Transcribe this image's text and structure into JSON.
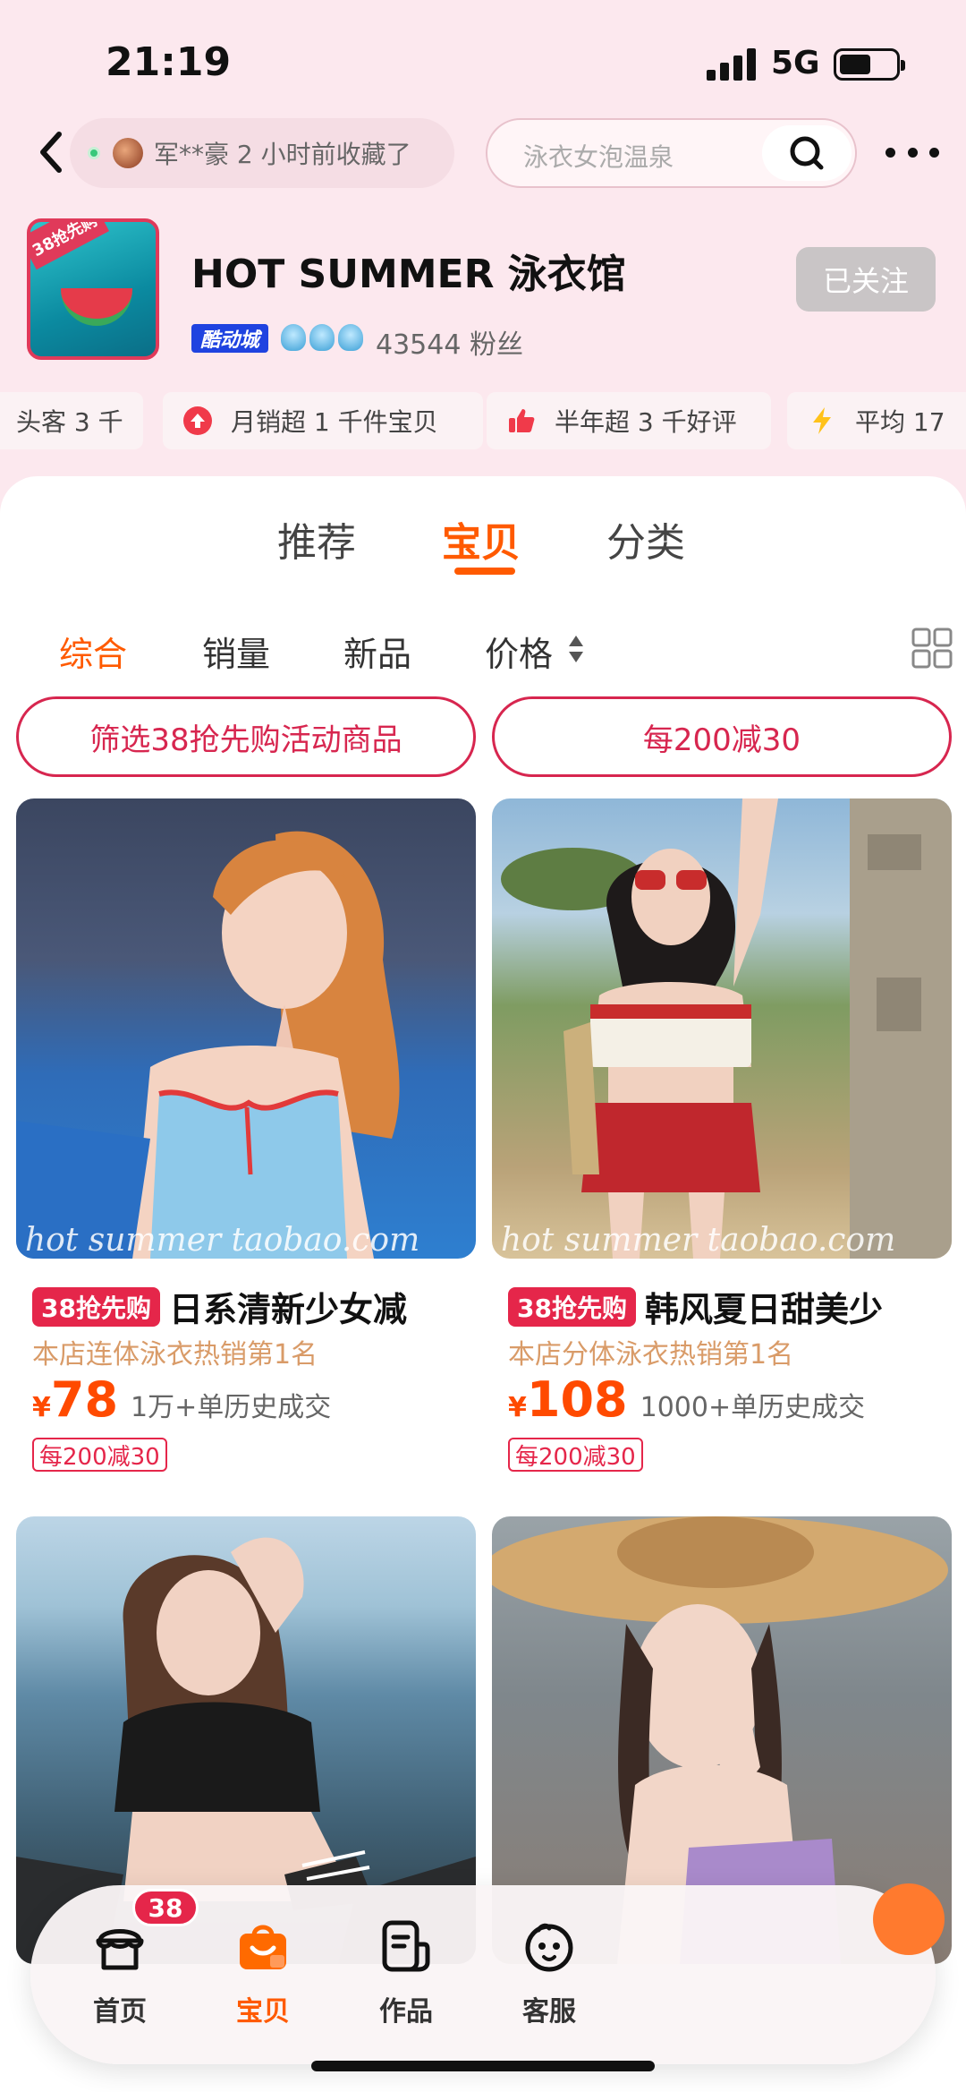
{
  "status_bar": {
    "time": "21:19",
    "network": "5G"
  },
  "top_nav": {
    "ticker_text": "军**豪 2 小时前收藏了",
    "search_placeholder": "泳衣女泡温泉"
  },
  "store": {
    "logo_tag": "38抢先购",
    "name": "HOT SUMMER 泳衣馆",
    "follow_label": "已关注",
    "badge": "酷动城",
    "fans": "43544 粉丝"
  },
  "highlights": [
    {
      "label": "头客 3 千",
      "icon": "none"
    },
    {
      "label": "月销超 1 千件宝贝",
      "icon": "up-arrow-icon"
    },
    {
      "label": "半年超 3 千好评",
      "icon": "thumb-up-icon"
    },
    {
      "label": "平均 17",
      "icon": "lightning-icon"
    }
  ],
  "tabs": [
    {
      "label": "推荐"
    },
    {
      "label": "宝贝"
    },
    {
      "label": "分类"
    }
  ],
  "sort": {
    "options": [
      "综合",
      "销量",
      "新品",
      "价格"
    ],
    "active": "综合"
  },
  "filters": [
    "筛选38抢先购活动商品",
    "每200减30"
  ],
  "products": [
    {
      "promo": "38抢先购",
      "title": "日系清新少女减",
      "rank": "本店连体泳衣热销第1名",
      "currency": "¥",
      "price": "78",
      "sold": "1万+单历史成交",
      "coupon": "每200减30",
      "watermark": "hot summer taobao.com"
    },
    {
      "promo": "38抢先购",
      "title": "韩风夏日甜美少",
      "rank": "本店分体泳衣热销第1名",
      "currency": "¥",
      "price": "108",
      "sold": "1000+单历史成交",
      "coupon": "每200减30",
      "watermark": "hot summer taobao.com"
    }
  ],
  "bottom_nav": [
    {
      "label": "首页",
      "icon": "shop-icon",
      "badge": "38"
    },
    {
      "label": "宝贝",
      "icon": "bag-icon"
    },
    {
      "label": "作品",
      "icon": "works-icon"
    },
    {
      "label": "客服",
      "icon": "service-icon"
    }
  ],
  "colors": {
    "accent": "#ff5a00",
    "promo_red": "#e5264a",
    "header_bg": "#fce8ee"
  }
}
